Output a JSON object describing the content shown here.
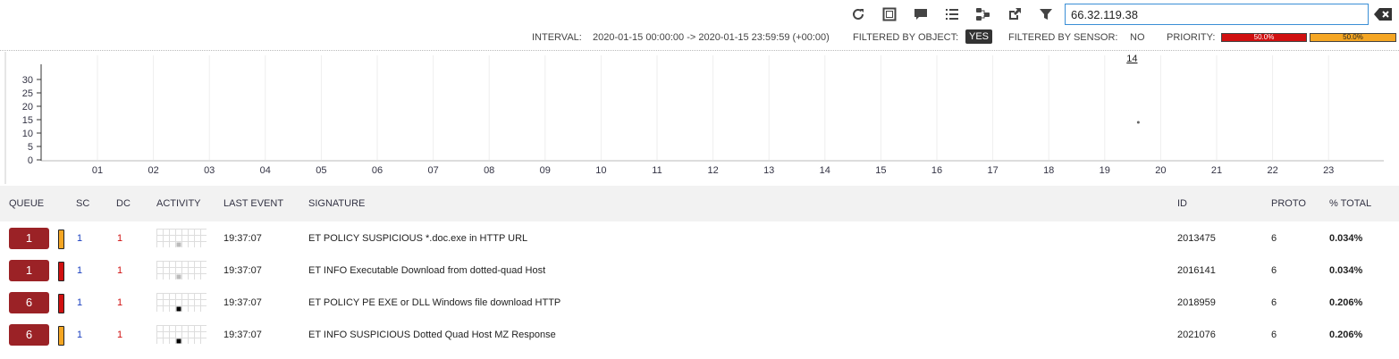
{
  "toolbar": {
    "icons": [
      "refresh-icon",
      "expand-icon",
      "comment-icon",
      "list-icon",
      "share-icon",
      "external-link-icon",
      "filter-icon"
    ],
    "search_value": "66.32.119.38"
  },
  "status": {
    "interval_label": "INTERVAL:",
    "interval_value": "2020-01-15 00:00:00 -> 2020-01-15 23:59:59 (+00:00)",
    "filtered_object_label": "FILTERED BY OBJECT:",
    "filtered_object_value": "YES",
    "filtered_sensor_label": "FILTERED BY SENSOR:",
    "filtered_sensor_value": "NO",
    "priority_label": "PRIORITY:",
    "priority": [
      {
        "value": "50.0%",
        "color": "#d01010"
      },
      {
        "value": "50.0%",
        "color": "#f5a623"
      }
    ]
  },
  "chart_data": {
    "type": "scatter",
    "y_ticks": [
      "30",
      "25",
      "20",
      "15",
      "10",
      "5",
      "0"
    ],
    "ylim": [
      0,
      33
    ],
    "x_ticks": [
      "01",
      "02",
      "03",
      "04",
      "05",
      "06",
      "07",
      "08",
      "09",
      "10",
      "11",
      "12",
      "13",
      "14",
      "15",
      "16",
      "17",
      "18",
      "19",
      "20",
      "21",
      "22",
      "23"
    ],
    "points": [
      {
        "x": 19.6,
        "y": 14
      }
    ],
    "annotation": "14",
    "grid": true
  },
  "table": {
    "headers": {
      "queue": "QUEUE",
      "sc": "SC",
      "dc": "DC",
      "activity": "ACTIVITY",
      "last_event": "LAST EVENT",
      "signature": "SIGNATURE",
      "id": "ID",
      "proto": "PROTO",
      "total": "% TOTAL"
    },
    "rows": [
      {
        "queue": "1",
        "priority_color": "#f5a623",
        "sc": "1",
        "dc": "1",
        "activity_level": "low",
        "last_event": "19:37:07",
        "signature": "ET POLICY SUSPICIOUS *.doc.exe in HTTP URL",
        "id": "2013475",
        "proto": "6",
        "total": "0.034%"
      },
      {
        "queue": "1",
        "priority_color": "#d01010",
        "sc": "1",
        "dc": "1",
        "activity_level": "low",
        "last_event": "19:37:07",
        "signature": "ET INFO Executable Download from dotted-quad Host",
        "id": "2016141",
        "proto": "6",
        "total": "0.034%"
      },
      {
        "queue": "6",
        "priority_color": "#d01010",
        "sc": "1",
        "dc": "1",
        "activity_level": "high",
        "last_event": "19:37:07",
        "signature": "ET POLICY PE EXE or DLL Windows file download HTTP",
        "id": "2018959",
        "proto": "6",
        "total": "0.206%"
      },
      {
        "queue": "6",
        "priority_color": "#f5a623",
        "sc": "1",
        "dc": "1",
        "activity_level": "high",
        "last_event": "19:37:07",
        "signature": "ET INFO SUSPICIOUS Dotted Quad Host MZ Response",
        "id": "2021076",
        "proto": "6",
        "total": "0.206%"
      }
    ]
  }
}
